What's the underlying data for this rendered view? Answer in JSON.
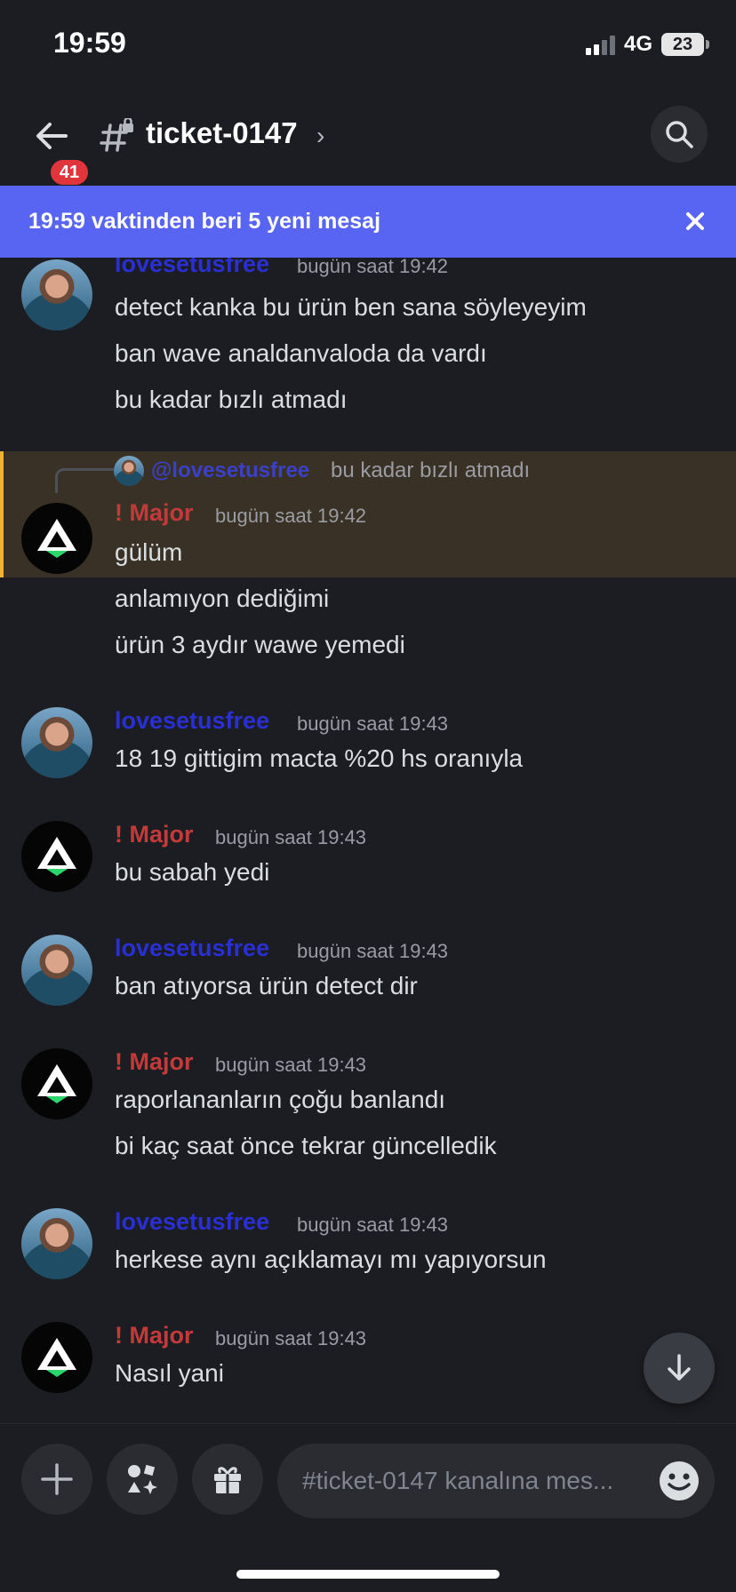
{
  "status_bar": {
    "time": "19:59",
    "network": "4G",
    "battery": "23"
  },
  "header": {
    "back_badge": "41",
    "channel_name": "ticket-0147",
    "chevron": "›"
  },
  "banner": {
    "text": "19:59 vaktinden beri 5 yeni mesaj",
    "close_icon": "close-icon"
  },
  "messages": [
    {
      "author": "lovesetusfree",
      "timestamp": "bugün saat 19:42",
      "lines": [
        "detect kanka bu ürün ben sana söyleyeyim",
        "ban wave analdanvaloda da vardı",
        "bu kadar bızlı atmadı"
      ]
    },
    {
      "reply": {
        "mention": "@lovesetusfree",
        "text": "bu kadar bızlı atmadı"
      },
      "author": "! Major",
      "timestamp": "bugün saat 19:42",
      "lines": [
        "gülüm",
        "anlamıyon dediğimi",
        "ürün 3 aydır wawe yemedi"
      ]
    },
    {
      "author": "lovesetusfree",
      "timestamp": "bugün saat 19:43",
      "lines": [
        "18 19 gittigim macta %20 hs oranıyla"
      ]
    },
    {
      "author": "! Major",
      "timestamp": "bugün saat 19:43",
      "lines": [
        "bu sabah yedi"
      ]
    },
    {
      "author": "lovesetusfree",
      "timestamp": "bugün saat 19:43",
      "lines": [
        "ban atıyorsa ürün detect dir"
      ]
    },
    {
      "author": "! Major",
      "timestamp": "bugün saat 19:43",
      "lines": [
        "raporlananların çoğu banlandı",
        "bi kaç saat önce tekrar güncelledik"
      ]
    },
    {
      "author": "lovesetusfree",
      "timestamp": "bugün saat 19:43",
      "lines": [
        "herkese aynı açıklamayı mı yapıyorsun"
      ]
    },
    {
      "author": "! Major",
      "timestamp": "bugün saat 19:43",
      "lines": [
        "Nasıl yani"
      ]
    }
  ],
  "composer": {
    "placeholder": "#ticket-0147 kanalına mes..."
  },
  "colors": {
    "accent": "#5865f2",
    "author_user": "#2a2fd4",
    "author_staff": "#c33a3a",
    "highlight": "#3a3126",
    "highlight_bar": "#f0b232",
    "badge": "#e0353b"
  }
}
